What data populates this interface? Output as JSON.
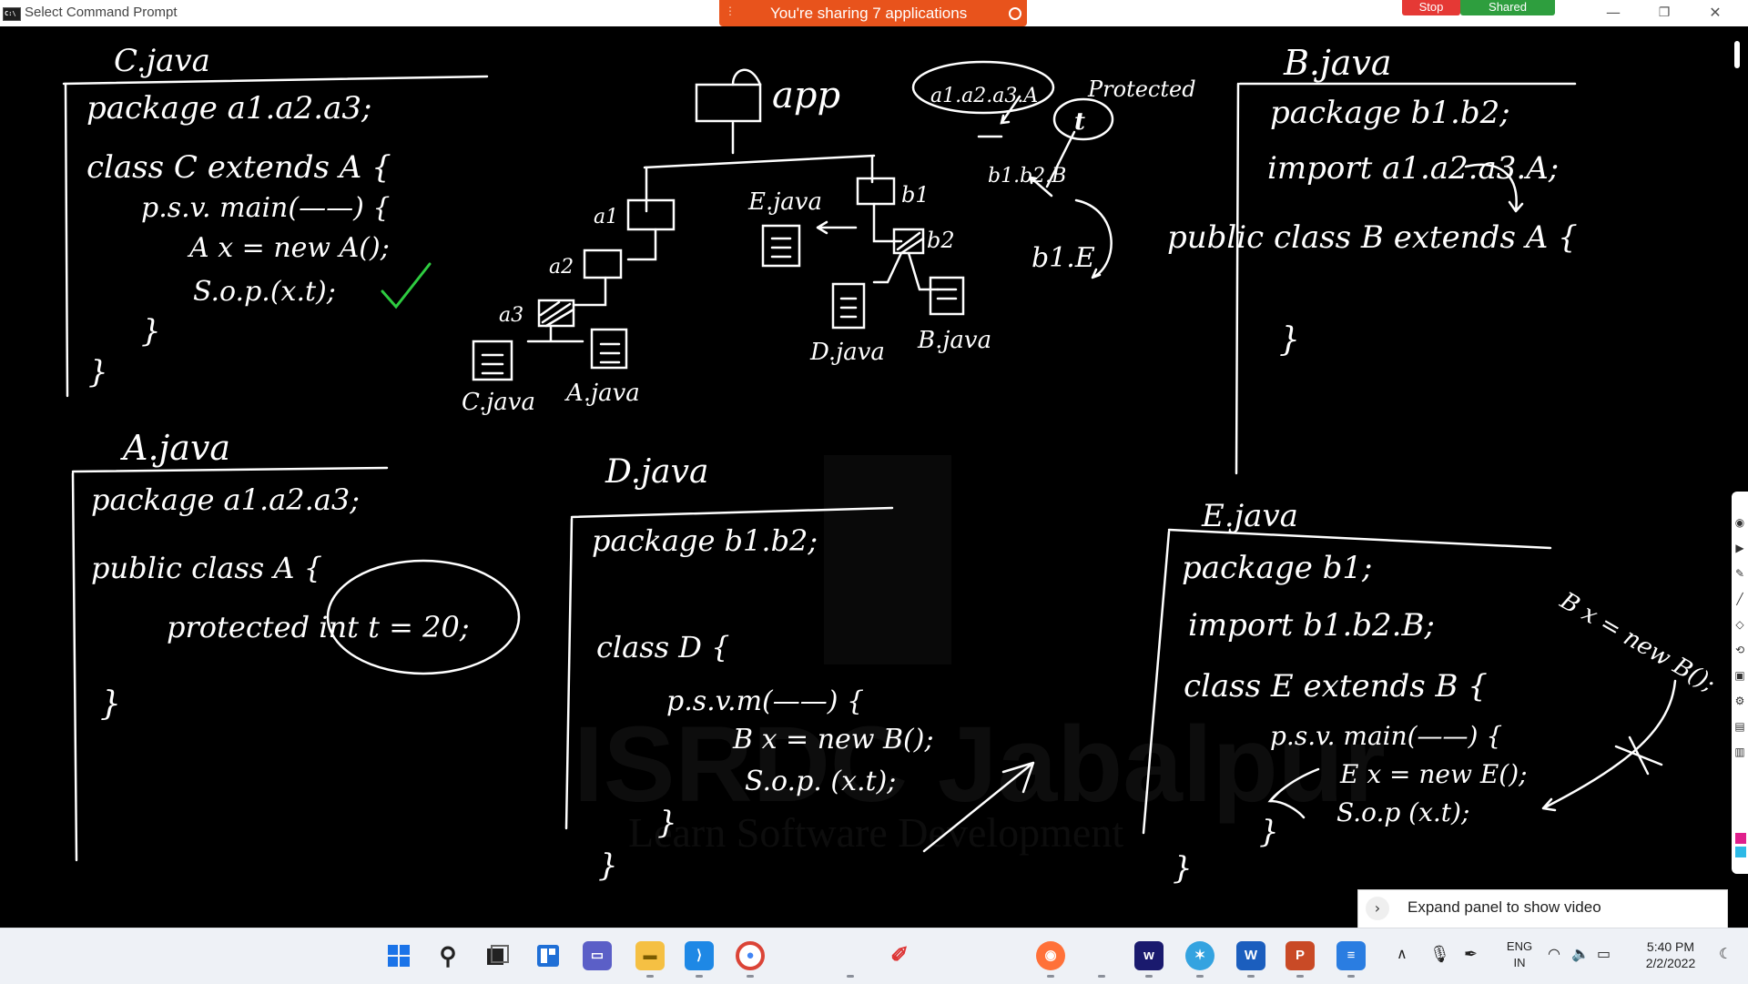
{
  "window": {
    "title": "Select Command Prompt",
    "icon": "cmd-icon"
  },
  "sharing": {
    "banner_text": "You're sharing 7 applications",
    "stop_label": "Stop",
    "shared_label": "Shared"
  },
  "board": {
    "c_java": {
      "title": "C.java",
      "lines": [
        "package a1.a2.a3;",
        "class C extends A {",
        "p.s.v. main(——) {",
        "A x = new A();",
        "S.o.p.(x.t);",
        "}",
        "}"
      ]
    },
    "tree": {
      "root": "app",
      "a1": "a1",
      "a2": "a2",
      "a3": "a3",
      "c_file": "C.java",
      "a_file": "A.java",
      "e_file": "E.java",
      "b1": "b1",
      "b2": "b2",
      "d_file": "D.java",
      "b_file": "B.java"
    },
    "note": {
      "a_class": "a1.a2.a3.A",
      "protected": "Protected",
      "t": "t",
      "b_class": "b1.b2.B",
      "e_class": "b1.E"
    },
    "b_java": {
      "title": "B.java",
      "lines": [
        "package b1.b2;",
        "import a1.a2.a3.A;",
        "public class B extends A {",
        "}"
      ]
    },
    "a_java": {
      "title": "A.java",
      "lines": [
        "package a1.a2.a3;",
        "public class A {",
        "protected int t = 20;",
        "}"
      ]
    },
    "d_java": {
      "title": "D.java",
      "lines": [
        "package b1.b2;",
        "class D {",
        "p.s.v.m(——) {",
        "B x = new B();",
        "S.o.p. (x.t);",
        "}",
        "}"
      ]
    },
    "e_java": {
      "title": "E.java",
      "lines": [
        "package b1;",
        "import b1.b2.B;",
        "class E extends B {",
        "p.s.v. main(——) {",
        "E x = new E();",
        "S.o.p (x.t);",
        "}",
        "}"
      ]
    },
    "side_note": "B x = new B();",
    "watermark": {
      "line1": "ISRDC Jabalpur",
      "line2": "Learn Software Development"
    },
    "colors": {
      "ink": "#ffffff",
      "check": "#2ecc40",
      "background": "#000000"
    }
  },
  "expand_panel": {
    "text": "Expand panel to show video"
  },
  "taskbar": {
    "apps": [
      "windows-start-icon",
      "search-icon",
      "task-view-icon",
      "widgets-icon",
      "teams-chat-icon",
      "file-explorer-icon",
      "vscode-icon",
      "chrome-icon",
      "paint-icon",
      "firefox-icon",
      "app-icon",
      "network-app-icon",
      "word-icon",
      "powerpoint-icon",
      "notepad-icon"
    ],
    "lang": {
      "line1": "ENG",
      "line2": "IN"
    },
    "clock": {
      "time": "5:40 PM",
      "date": "2/2/2022"
    }
  }
}
